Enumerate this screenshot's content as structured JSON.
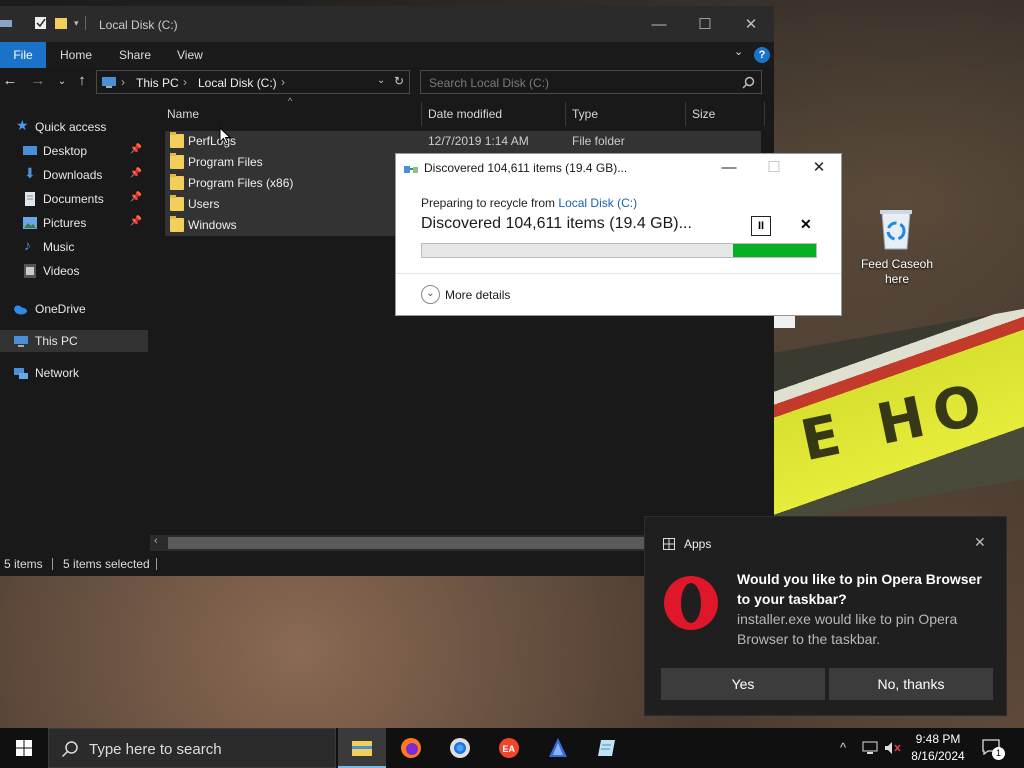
{
  "explorer": {
    "title": "Local Disk (C:)",
    "ribbon_tabs": [
      "File",
      "Home",
      "Share",
      "View"
    ],
    "breadcrumb": [
      "This PC",
      "Local Disk (C:)"
    ],
    "search_placeholder": "Search Local Disk (C:)",
    "nav": {
      "quick_access": "Quick access",
      "desktop": "Desktop",
      "downloads": "Downloads",
      "documents": "Documents",
      "pictures": "Pictures",
      "music": "Music",
      "videos": "Videos",
      "onedrive": "OneDrive",
      "this_pc": "This PC",
      "network": "Network"
    },
    "columns": {
      "name": "Name",
      "date": "Date modified",
      "type": "Type",
      "size": "Size"
    },
    "files": [
      {
        "name": "PerfLogs",
        "date": "12/7/2019 1:14 AM",
        "type": "File folder"
      },
      {
        "name": "Program Files",
        "date": "",
        "type": ""
      },
      {
        "name": "Program Files (x86)",
        "date": "",
        "type": ""
      },
      {
        "name": "Users",
        "date": "",
        "type": ""
      },
      {
        "name": "Windows",
        "date": "",
        "type": ""
      }
    ],
    "status": {
      "count": "5 items",
      "selected": "5 items selected"
    }
  },
  "progress_dialog": {
    "title": "Discovered 104,611 items (19.4 GB)...",
    "subtitle_prefix": "Preparing to recycle from ",
    "subtitle_link": "Local Disk (C:)",
    "main": "Discovered 104,611 items (19.4 GB)...",
    "progress_fraction": 0.21,
    "more_details": "More details",
    "progress_color": "#06b025"
  },
  "desktop_icon": {
    "label": "Feed Caseoh here",
    "icon": "recycle-bin-icon"
  },
  "toast": {
    "app": "Apps",
    "title": "Would you like to pin Opera Browser to your taskbar?",
    "body": "installer.exe would like to pin Opera Browser to the taskbar.",
    "yes": "Yes",
    "no": "No, thanks"
  },
  "taskbar": {
    "search_placeholder": "Type here to search",
    "time": "9:48 PM",
    "date": "8/16/2024",
    "notification_count": "1",
    "apps": [
      "file-explorer-icon",
      "firefox-icon",
      "chrome-icon",
      "ea-icon",
      "app-icon",
      "notepad-icon"
    ]
  },
  "background": {
    "text": "E HO"
  },
  "colors": {
    "accent": "#1a73c8",
    "explorer_bg": "#191919",
    "toast_bg": "#1f1f1f",
    "opera_red": "#e0162b"
  }
}
